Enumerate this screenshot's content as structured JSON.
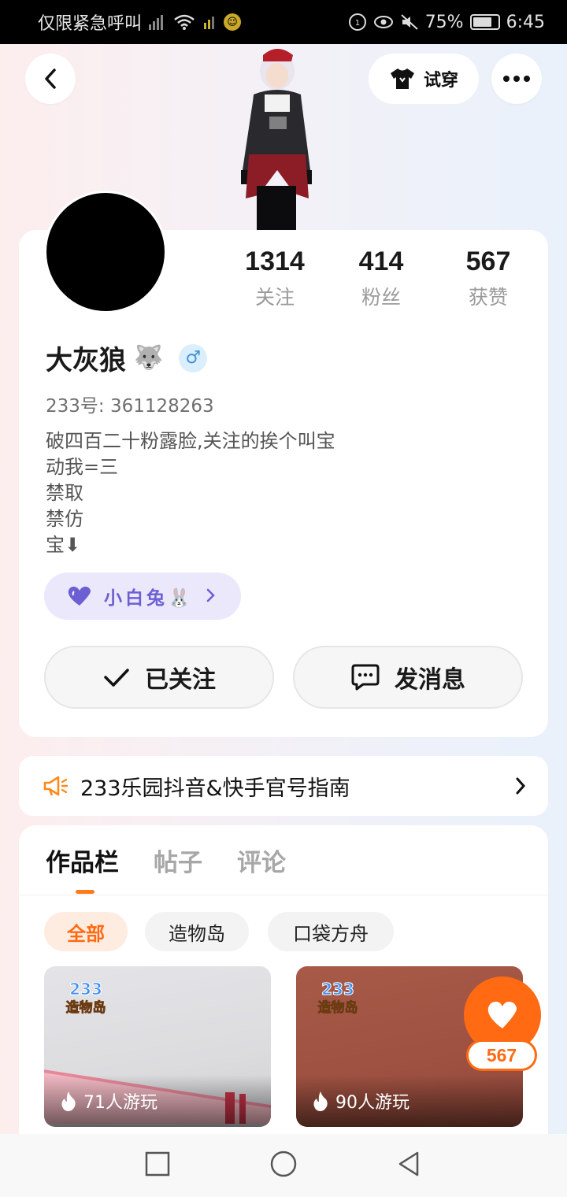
{
  "status_bar": {
    "carrier": "仅限紧急呼叫",
    "battery": "75%",
    "time": "6:45"
  },
  "header": {
    "try_on_label": "试穿"
  },
  "profile": {
    "stats": [
      {
        "value": "1314",
        "label": "关注"
      },
      {
        "value": "414",
        "label": "粉丝"
      },
      {
        "value": "567",
        "label": "获赞"
      }
    ],
    "name": "大灰狼",
    "name_emoji": "🐺",
    "gender_symbol": "♂",
    "uid": "233号: 361128263",
    "bio_lines": [
      "破四百二十粉露脸,关注的挨个叫宝",
      "动我=三",
      "禁取",
      "禁仿",
      "宝⬇"
    ],
    "tag_label": "小白兔🐰",
    "follow_label": "已关注",
    "message_label": "发消息"
  },
  "announcement": {
    "text": "233乐园抖音&快手官号指南"
  },
  "works": {
    "tabs": [
      "作品栏",
      "帖子",
      "评论"
    ],
    "filters": [
      "全部",
      "造物岛",
      "口袋方舟"
    ],
    "items": [
      {
        "plays": "71人游玩",
        "logo_text": "233 造物岛"
      },
      {
        "plays": "90人游玩",
        "logo_text": "233 造物岛"
      }
    ],
    "like_count": "567"
  },
  "colors": {
    "accent": "#ff6a13",
    "tag_purple": "#6c5fd3",
    "gender_blue": "#3d93d9"
  }
}
